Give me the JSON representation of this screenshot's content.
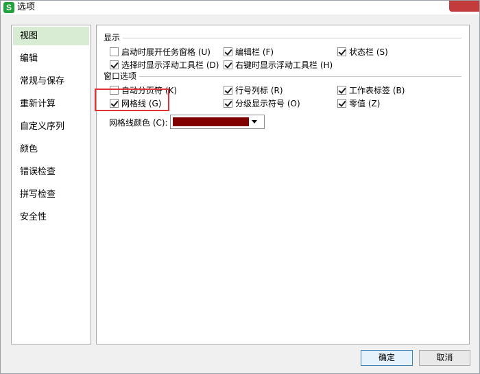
{
  "window": {
    "title": "选项",
    "app_icon_letter": "S"
  },
  "sidebar": {
    "items": [
      {
        "label": "视图",
        "active": true
      },
      {
        "label": "编辑",
        "active": false
      },
      {
        "label": "常规与保存",
        "active": false
      },
      {
        "label": "重新计算",
        "active": false
      },
      {
        "label": "自定义序列",
        "active": false
      },
      {
        "label": "颜色",
        "active": false
      },
      {
        "label": "错误检查",
        "active": false
      },
      {
        "label": "拼写检查",
        "active": false
      },
      {
        "label": "安全性",
        "active": false
      }
    ]
  },
  "display": {
    "group_label": "显示",
    "options": [
      {
        "label": "启动时展开任务窗格 (U)",
        "checked": false
      },
      {
        "label": "编辑栏 (F)",
        "checked": true
      },
      {
        "label": "状态栏 (S)",
        "checked": true
      },
      {
        "label": "选择时显示浮动工具栏 (D)",
        "checked": true
      },
      {
        "label": "右键时显示浮动工具栏 (H)",
        "checked": true
      }
    ]
  },
  "window_options": {
    "group_label": "窗口选项",
    "options": [
      {
        "label": "自动分页符 (K)",
        "checked": false
      },
      {
        "label": "行号列标 (R)",
        "checked": true
      },
      {
        "label": "工作表标签 (B)",
        "checked": true
      },
      {
        "label": "网格线 (G)",
        "checked": true
      },
      {
        "label": "分级显示符号 (O)",
        "checked": true
      },
      {
        "label": "零值 (Z)",
        "checked": true
      }
    ],
    "grid_color_label": "网格线颜色 (C):",
    "grid_color_value": "#800000"
  },
  "buttons": {
    "ok": "确定",
    "cancel": "取消"
  }
}
